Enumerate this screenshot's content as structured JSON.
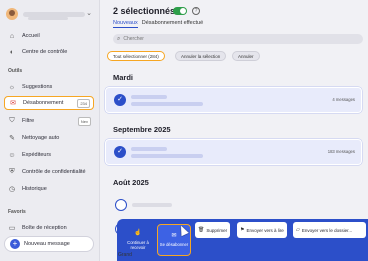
{
  "sidebar": {
    "items": [
      {
        "label": "Accueil",
        "icon": "home-icon"
      },
      {
        "label": "Centre de contrôle",
        "icon": "control-icon"
      },
      {
        "label": "Suggestions",
        "icon": "bulb-icon"
      },
      {
        "label": "Désabonnement",
        "icon": "unsubscribe-icon",
        "badge": "234"
      },
      {
        "label": "Filtre",
        "icon": "filter-icon",
        "badge": "Nev"
      },
      {
        "label": "Nettoyage auto",
        "icon": "broom-icon"
      },
      {
        "label": "Expéditeurs",
        "icon": "users-icon"
      },
      {
        "label": "Contrôle de confidentialité",
        "icon": "shield-icon"
      },
      {
        "label": "Historique",
        "icon": "clock-icon"
      },
      {
        "label": "Boîte de réception",
        "icon": "inbox-icon"
      }
    ],
    "section_outils": "Outils",
    "section_favoris": "Favoris",
    "new_message": "Nouveau message"
  },
  "main": {
    "title": "2 sélectionnés",
    "tabs": [
      "Nouveaux",
      "Désabonnement effectué"
    ],
    "search_placeholder": "Chercher",
    "chips": [
      "Tout sélectionner (284)",
      "Annuler la sélection",
      "Annuler"
    ],
    "groups": [
      {
        "date": "Mardi",
        "count": "4 messages"
      },
      {
        "date": "Septembre 2025",
        "count": "183 messages"
      },
      {
        "date": "Août 2025"
      }
    ]
  },
  "actions": {
    "continue": "Continuer à recevoir",
    "unsubscribe": "Se désabonner",
    "delete": "Supprimer",
    "send_to_trash": "Envoyer vers à lire",
    "send_to_folder": "Envoyer vers le dossier...",
    "peek_label": "Grand"
  }
}
